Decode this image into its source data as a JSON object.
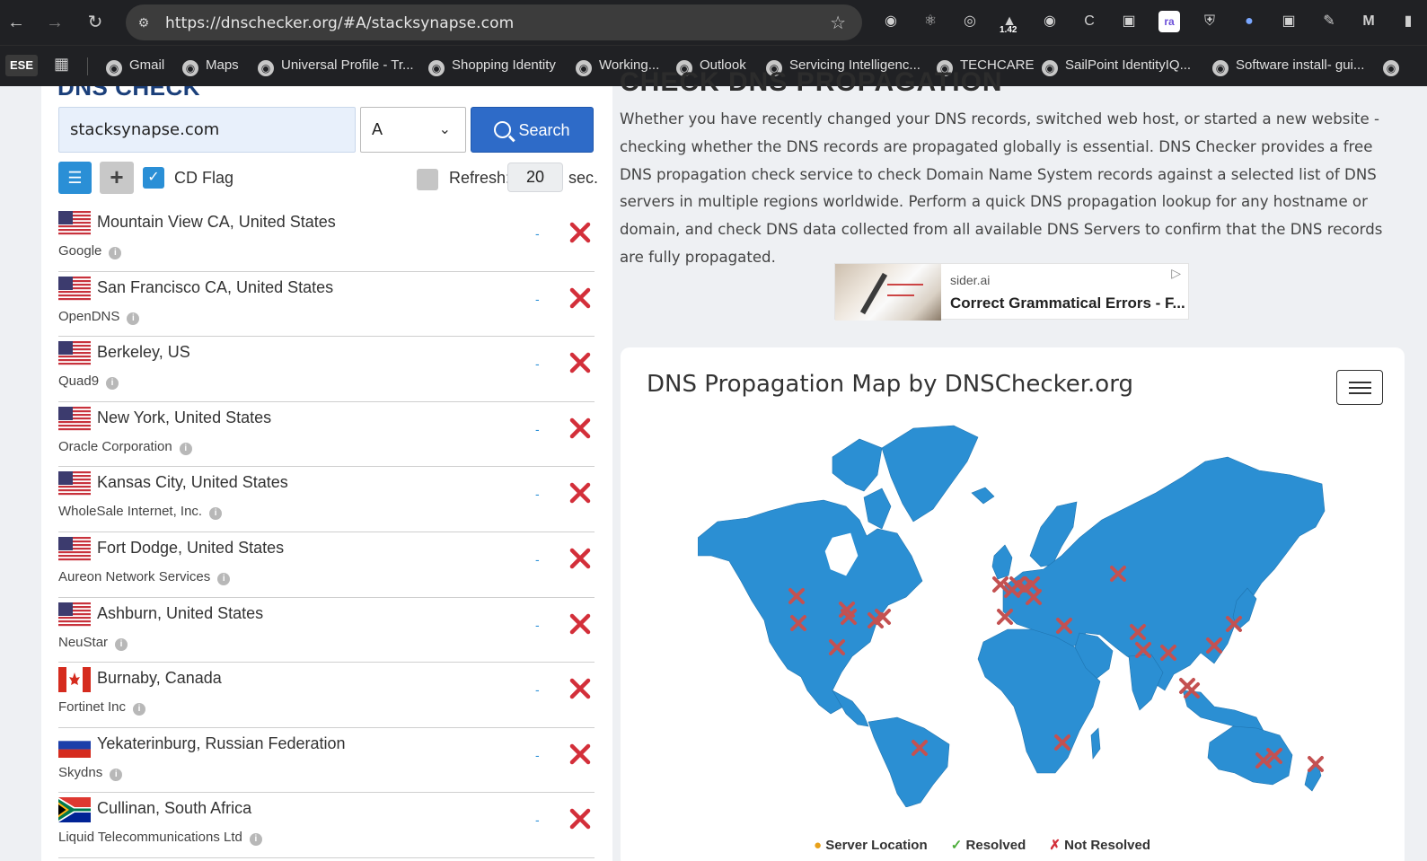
{
  "browser": {
    "url": "https://dnschecker.org/#A/stacksynapse.com",
    "extension_badge": "1.42",
    "profile_label": "ESE",
    "bookmarks": [
      {
        "label": "Gmail"
      },
      {
        "label": "Maps"
      },
      {
        "label": "Universal Profile - Tr..."
      },
      {
        "label": "Shopping Identity"
      },
      {
        "label": "Working..."
      },
      {
        "label": "Outlook"
      },
      {
        "label": "Servicing Intelligenc..."
      },
      {
        "label": "TECHCARE"
      },
      {
        "label": "SailPoint IdentityIQ..."
      },
      {
        "label": "Software install- gui..."
      }
    ]
  },
  "left": {
    "heading": "DNS CHECK",
    "domain_value": "stacksynapse.com",
    "record_type": "A",
    "search_label": "Search",
    "cd_flag_label": "CD Flag",
    "cd_flag_checked": true,
    "refresh_label": "Refresh:",
    "refresh_value": "20",
    "refresh_unit": "sec.",
    "servers": [
      {
        "location": "Mountain View CA, United States",
        "provider": "Google",
        "flag": "us",
        "result": "-",
        "status": "not-resolved"
      },
      {
        "location": "San Francisco CA, United States",
        "provider": "OpenDNS",
        "flag": "us",
        "result": "-",
        "status": "not-resolved"
      },
      {
        "location": "Berkeley, US",
        "provider": "Quad9",
        "flag": "us",
        "result": "-",
        "status": "not-resolved"
      },
      {
        "location": "New York, United States",
        "provider": "Oracle Corporation",
        "flag": "us",
        "result": "-",
        "status": "not-resolved"
      },
      {
        "location": "Kansas City, United States",
        "provider": "WholeSale Internet, Inc.",
        "flag": "us",
        "result": "-",
        "status": "not-resolved"
      },
      {
        "location": "Fort Dodge, United States",
        "provider": "Aureon Network Services",
        "flag": "us",
        "result": "-",
        "status": "not-resolved"
      },
      {
        "location": "Ashburn, United States",
        "provider": "NeuStar",
        "flag": "us",
        "result": "-",
        "status": "not-resolved"
      },
      {
        "location": "Burnaby, Canada",
        "provider": "Fortinet Inc",
        "flag": "ca",
        "result": "-",
        "status": "not-resolved"
      },
      {
        "location": "Yekaterinburg, Russian Federation",
        "provider": "Skydns",
        "flag": "ru",
        "result": "-",
        "status": "not-resolved"
      },
      {
        "location": "Cullinan, South Africa",
        "provider": "Liquid Telecommunications Ltd",
        "flag": "za",
        "result": "-",
        "status": "not-resolved"
      }
    ]
  },
  "right": {
    "heading": "CHECK DNS PROPAGATION",
    "description": "Whether you have recently changed your DNS records, switched web host, or started a new website - checking whether the DNS records are propagated globally is essential. DNS Checker provides a free DNS propagation check service to check Domain Name System records against a selected list of DNS servers in multiple regions worldwide. Perform a quick DNS propagation lookup for any hostname or domain, and check DNS data collected from all available DNS Servers to confirm that the DNS records are fully propagated.",
    "ad": {
      "source": "sider.ai",
      "title": "Correct Grammatical Errors - F..."
    },
    "map": {
      "title": "DNS Propagation Map by DNSChecker.org",
      "legend": {
        "server": "Server Location",
        "resolved": "Resolved",
        "not_resolved": "Not Resolved"
      }
    }
  },
  "colors": {
    "accent": "#2e6bc8",
    "map_land": "#2b8fd3",
    "fail": "#d32f3a",
    "marker_fill": "#c45151"
  }
}
